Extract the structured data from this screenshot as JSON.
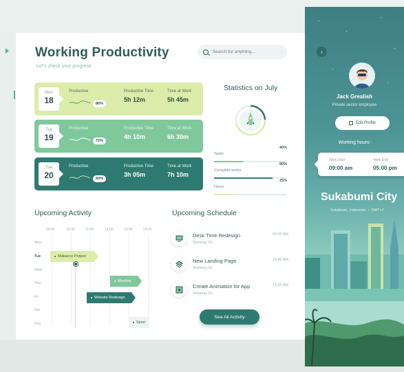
{
  "header": {
    "title": "Working Productivity",
    "subtitle": "Let's check your progress",
    "search_placeholder": "Search for anything..."
  },
  "days": [
    {
      "dow": "Mon",
      "day": "18",
      "productive_label": "Productive",
      "productive_pct": "86%",
      "time_label": "Productive Time",
      "time_value": "5h 12m",
      "work_label": "Time at Work",
      "work_value": "5h 45m"
    },
    {
      "dow": "Tue",
      "day": "19",
      "productive_label": "Productive",
      "productive_pct": "72%",
      "time_label": "Productive Time",
      "time_value": "4h 10m",
      "work_label": "Time at Work",
      "work_value": "6h 30m"
    },
    {
      "dow": "Tue",
      "day": "20",
      "productive_label": "Productive",
      "productive_pct": "60%",
      "time_label": "Productive Time",
      "time_value": "3h 05m",
      "work_label": "Time at Work",
      "work_value": "7h 10m"
    }
  ],
  "statistics": {
    "title": "Statistics on July",
    "rows": [
      {
        "label": "Tasks",
        "value": "40%",
        "fraction": 0.4,
        "color": "#7fc89c"
      },
      {
        "label": "Complete works",
        "value": "80%",
        "fraction": 0.8,
        "color": "#2e7a70"
      },
      {
        "label": "Hours",
        "value": "25%",
        "fraction": 0.25,
        "color": "#dcecaa"
      }
    ]
  },
  "activity": {
    "title": "Upcoming Activity",
    "hours": [
      "09:00",
      "10:00",
      "11:00",
      "12:00",
      "13:00",
      "14:00"
    ],
    "days": [
      "Mon",
      "Tue",
      "Wed",
      "Thu",
      "Fri",
      "Sat",
      "Sun"
    ],
    "active_day": "Tue",
    "items": [
      "Mabacco Project",
      "Meeting",
      "Website Redesign",
      "Sport"
    ]
  },
  "schedule": {
    "title": "Upcoming Schedule",
    "items": [
      {
        "name": "Desk Time Redesign",
        "status": "Working On",
        "time": "09:30 AM",
        "icon": "monitor-icon"
      },
      {
        "name": "New Landing Page",
        "status": "Working On",
        "time": "10:40 AM",
        "icon": "layers-icon"
      },
      {
        "name": "Create Animation for App",
        "status": "Working On",
        "time": "11:50 AM",
        "icon": "image-icon"
      }
    ],
    "see_all": "See All Activity"
  },
  "profile": {
    "name": "Jack Grealish",
    "role": "Private sector employee",
    "edit": "Edit Profile",
    "working_hours_title": "Working hours:",
    "start_label": "Work Start",
    "start_value": "09:00 am",
    "end_label": "Work End",
    "end_value": "05:00 pm",
    "city": "Sukabumi City",
    "location": "Sukabumi, Indonesia",
    "tz": "GMT+7"
  }
}
